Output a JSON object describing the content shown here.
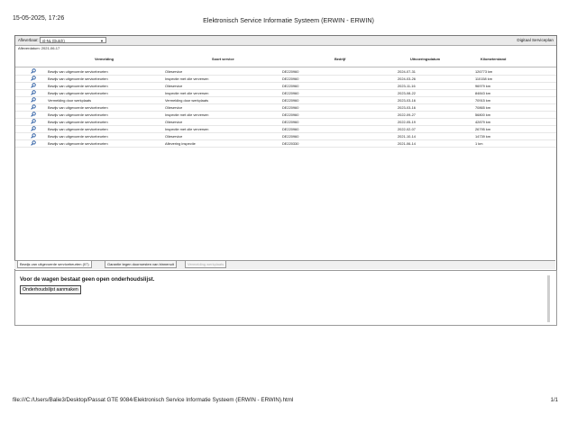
{
  "print_header": {
    "date": "15-05-2025, 17:26",
    "title": "Elektronisch Service Informatie Systeem (ERWIN - ERWIN)"
  },
  "toolbar": {
    "language_label": "Afleverbaar:",
    "language_value": "nl-NL (Dutch)",
    "right_label": "Digitaal Serviceplan"
  },
  "delivery_date": "Afleverdatum: 2021-06-17",
  "table": {
    "columns": [
      "Vermelding",
      "Soort service",
      "Bedrijf",
      "Uitvoeringsdatum",
      "Kilometerstand"
    ],
    "rows": [
      [
        "Bewijs van uitgevoerde servicebeurten",
        "Olieservice",
        "DE220960",
        "2024-07-31",
        "126773 km"
      ],
      [
        "Bewijs van uitgevoerde servicebeurten",
        "Inspectie met olie verversen",
        "DE220960",
        "2024-03-26",
        "110158 km"
      ],
      [
        "Bewijs van uitgevoerde servicebeurten",
        "Olieservice",
        "DE220960",
        "2023-11-16",
        "96979 km"
      ],
      [
        "Bewijs van uitgevoerde servicebeurten",
        "Inspectie met olie verversen",
        "DE220960",
        "2023-08-22",
        "84843 km"
      ],
      [
        "Vermelding door werkplaats",
        "Vermelding door werkplaats",
        "DE220960",
        "2023-03-16",
        "70915 km"
      ],
      [
        "Bewijs van uitgevoerde servicebeurten",
        "Olieservice",
        "DE220960",
        "2023-03-16",
        "70865 km"
      ],
      [
        "Bewijs van uitgevoerde servicebeurten",
        "Inspectie met olie verversen",
        "DE220960",
        "2022-09-27",
        "56800 km"
      ],
      [
        "Bewijs van uitgevoerde servicebeurten",
        "Olieservice",
        "DE220960",
        "2022-05-19",
        "42879 km"
      ],
      [
        "Bewijs van uitgevoerde servicebeurten",
        "Inspectie met olie verversen",
        "DE220960",
        "2022-02-07",
        "26795 km"
      ],
      [
        "Bewijs van uitgevoerde servicebeurten",
        "Olieservice",
        "DE220960",
        "2021-10-14",
        "14739 km"
      ],
      [
        "Bewijs van uitgevoerde servicebeurten",
        "Aflevering inspectie",
        "DE220330",
        "2021-06-14",
        "1 km"
      ]
    ]
  },
  "tabs": [
    {
      "label": "Bewijs van uitgevoerde servicebeurten (07)",
      "state": "active"
    },
    {
      "label": "Garantie tegen doorroesten van binnenuit",
      "state": "normal"
    },
    {
      "label": "Vermelding werkplaats",
      "state": "disabled"
    }
  ],
  "panel": {
    "message": "Voor de wagen bestaat geen open onderhoudslijst.",
    "button": "Onderhoudslijst aanmaken"
  },
  "print_footer": {
    "path": "file:///C:/Users/Balie3/Desktop/Passat GTE 9084/Elektronisch Service Informatie Systeem (ERWIN - ERWIN).html",
    "page": "1/1"
  },
  "icons": {
    "row_action": "magnifier-icon"
  }
}
